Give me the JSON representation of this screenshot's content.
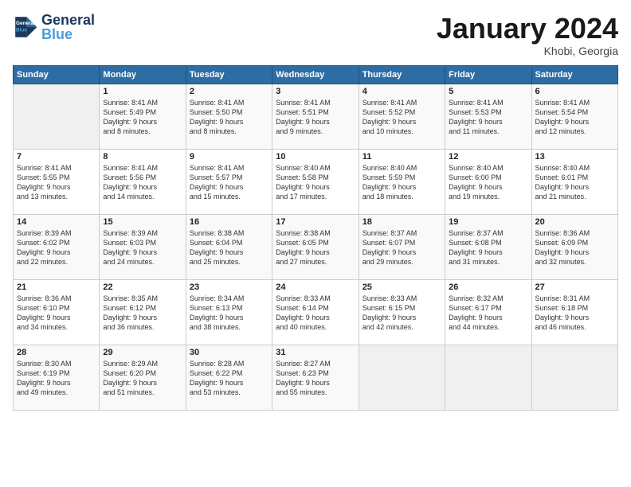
{
  "logo": {
    "line1": "General",
    "line2": "Blue"
  },
  "title": "January 2024",
  "location": "Khobi, Georgia",
  "days_header": [
    "Sunday",
    "Monday",
    "Tuesday",
    "Wednesday",
    "Thursday",
    "Friday",
    "Saturday"
  ],
  "weeks": [
    [
      {
        "day": "",
        "content": ""
      },
      {
        "day": "1",
        "content": "Sunrise: 8:41 AM\nSunset: 5:49 PM\nDaylight: 9 hours\nand 8 minutes."
      },
      {
        "day": "2",
        "content": "Sunrise: 8:41 AM\nSunset: 5:50 PM\nDaylight: 9 hours\nand 8 minutes."
      },
      {
        "day": "3",
        "content": "Sunrise: 8:41 AM\nSunset: 5:51 PM\nDaylight: 9 hours\nand 9 minutes."
      },
      {
        "day": "4",
        "content": "Sunrise: 8:41 AM\nSunset: 5:52 PM\nDaylight: 9 hours\nand 10 minutes."
      },
      {
        "day": "5",
        "content": "Sunrise: 8:41 AM\nSunset: 5:53 PM\nDaylight: 9 hours\nand 11 minutes."
      },
      {
        "day": "6",
        "content": "Sunrise: 8:41 AM\nSunset: 5:54 PM\nDaylight: 9 hours\nand 12 minutes."
      }
    ],
    [
      {
        "day": "7",
        "content": "Sunrise: 8:41 AM\nSunset: 5:55 PM\nDaylight: 9 hours\nand 13 minutes."
      },
      {
        "day": "8",
        "content": "Sunrise: 8:41 AM\nSunset: 5:56 PM\nDaylight: 9 hours\nand 14 minutes."
      },
      {
        "day": "9",
        "content": "Sunrise: 8:41 AM\nSunset: 5:57 PM\nDaylight: 9 hours\nand 15 minutes."
      },
      {
        "day": "10",
        "content": "Sunrise: 8:40 AM\nSunset: 5:58 PM\nDaylight: 9 hours\nand 17 minutes."
      },
      {
        "day": "11",
        "content": "Sunrise: 8:40 AM\nSunset: 5:59 PM\nDaylight: 9 hours\nand 18 minutes."
      },
      {
        "day": "12",
        "content": "Sunrise: 8:40 AM\nSunset: 6:00 PM\nDaylight: 9 hours\nand 19 minutes."
      },
      {
        "day": "13",
        "content": "Sunrise: 8:40 AM\nSunset: 6:01 PM\nDaylight: 9 hours\nand 21 minutes."
      }
    ],
    [
      {
        "day": "14",
        "content": "Sunrise: 8:39 AM\nSunset: 6:02 PM\nDaylight: 9 hours\nand 22 minutes."
      },
      {
        "day": "15",
        "content": "Sunrise: 8:39 AM\nSunset: 6:03 PM\nDaylight: 9 hours\nand 24 minutes."
      },
      {
        "day": "16",
        "content": "Sunrise: 8:38 AM\nSunset: 6:04 PM\nDaylight: 9 hours\nand 25 minutes."
      },
      {
        "day": "17",
        "content": "Sunrise: 8:38 AM\nSunset: 6:05 PM\nDaylight: 9 hours\nand 27 minutes."
      },
      {
        "day": "18",
        "content": "Sunrise: 8:37 AM\nSunset: 6:07 PM\nDaylight: 9 hours\nand 29 minutes."
      },
      {
        "day": "19",
        "content": "Sunrise: 8:37 AM\nSunset: 6:08 PM\nDaylight: 9 hours\nand 31 minutes."
      },
      {
        "day": "20",
        "content": "Sunrise: 8:36 AM\nSunset: 6:09 PM\nDaylight: 9 hours\nand 32 minutes."
      }
    ],
    [
      {
        "day": "21",
        "content": "Sunrise: 8:36 AM\nSunset: 6:10 PM\nDaylight: 9 hours\nand 34 minutes."
      },
      {
        "day": "22",
        "content": "Sunrise: 8:35 AM\nSunset: 6:12 PM\nDaylight: 9 hours\nand 36 minutes."
      },
      {
        "day": "23",
        "content": "Sunrise: 8:34 AM\nSunset: 6:13 PM\nDaylight: 9 hours\nand 38 minutes."
      },
      {
        "day": "24",
        "content": "Sunrise: 8:33 AM\nSunset: 6:14 PM\nDaylight: 9 hours\nand 40 minutes."
      },
      {
        "day": "25",
        "content": "Sunrise: 8:33 AM\nSunset: 6:15 PM\nDaylight: 9 hours\nand 42 minutes."
      },
      {
        "day": "26",
        "content": "Sunrise: 8:32 AM\nSunset: 6:17 PM\nDaylight: 9 hours\nand 44 minutes."
      },
      {
        "day": "27",
        "content": "Sunrise: 8:31 AM\nSunset: 6:18 PM\nDaylight: 9 hours\nand 46 minutes."
      }
    ],
    [
      {
        "day": "28",
        "content": "Sunrise: 8:30 AM\nSunset: 6:19 PM\nDaylight: 9 hours\nand 49 minutes."
      },
      {
        "day": "29",
        "content": "Sunrise: 8:29 AM\nSunset: 6:20 PM\nDaylight: 9 hours\nand 51 minutes."
      },
      {
        "day": "30",
        "content": "Sunrise: 8:28 AM\nSunset: 6:22 PM\nDaylight: 9 hours\nand 53 minutes."
      },
      {
        "day": "31",
        "content": "Sunrise: 8:27 AM\nSunset: 6:23 PM\nDaylight: 9 hours\nand 55 minutes."
      },
      {
        "day": "",
        "content": ""
      },
      {
        "day": "",
        "content": ""
      },
      {
        "day": "",
        "content": ""
      }
    ]
  ]
}
